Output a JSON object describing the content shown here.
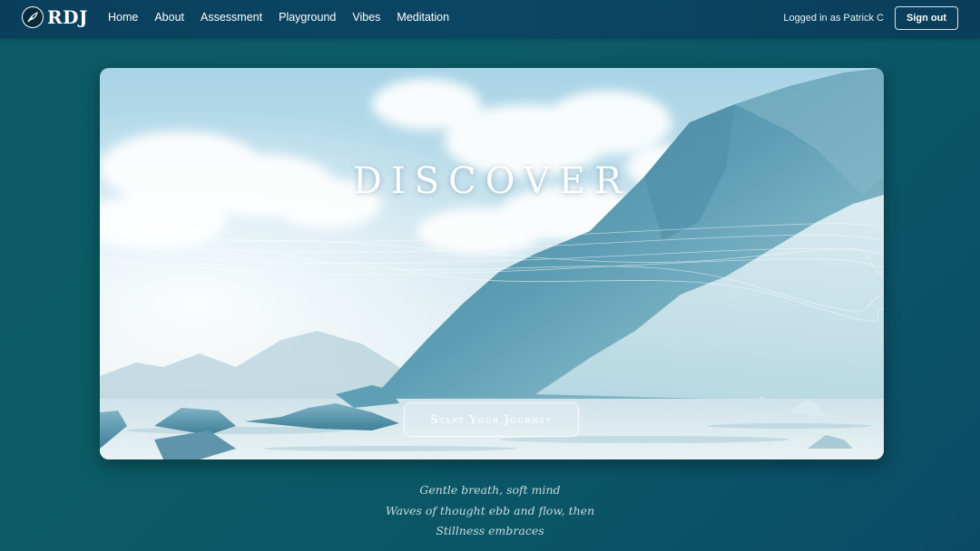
{
  "brand": {
    "name": "RDJ"
  },
  "nav": {
    "links": [
      {
        "label": "Home"
      },
      {
        "label": "About"
      },
      {
        "label": "Assessment"
      },
      {
        "label": "Playground"
      },
      {
        "label": "Vibes"
      },
      {
        "label": "Meditation"
      }
    ]
  },
  "user": {
    "status": "Logged in as Patrick C",
    "signout_label": "Sign out"
  },
  "hero": {
    "title": "DISCOVER",
    "cta_label": "Start Your Journey"
  },
  "haiku": {
    "lines": [
      "Gentle breath, soft mind",
      "Waves of thought ebb and flow, then",
      "Stillness embraces"
    ]
  },
  "colors": {
    "navbar": "#0a4262",
    "background": "#0b5864",
    "accent": "#ffffff"
  }
}
